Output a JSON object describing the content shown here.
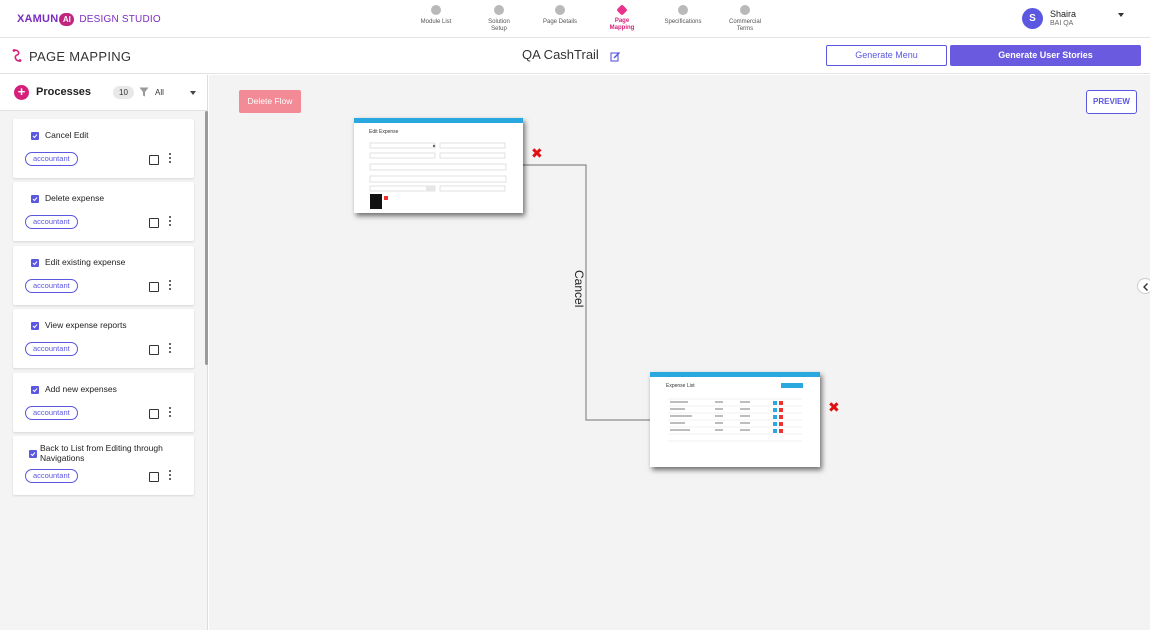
{
  "header": {
    "logo_brand": "XAMUN",
    "logo_ai": "AI",
    "logo_suffix": "DESIGN STUDIO",
    "steps": [
      {
        "label": "Module List",
        "active": false
      },
      {
        "label": "Solution Setup",
        "active": false
      },
      {
        "label": "Page Details",
        "active": false
      },
      {
        "label": "Page Mapping",
        "active": true
      },
      {
        "label": "Specifications",
        "active": false
      },
      {
        "label": "Commercial Terms",
        "active": false
      }
    ],
    "user": {
      "initial": "S",
      "name": "Shaira",
      "role": "BAI QA"
    }
  },
  "subheader": {
    "page_title": "PAGE MAPPING",
    "project_title": "QA CashTrail",
    "generate_menu": "Generate Menu",
    "generate_stories": "Generate User Stories"
  },
  "sidebar": {
    "processes_label": "Processes",
    "count": "10",
    "filter_value": "All",
    "items": [
      {
        "title": "Cancel Edit",
        "role": "accountant"
      },
      {
        "title": "Delete expense",
        "role": "accountant"
      },
      {
        "title": "Edit existing expense",
        "role": "accountant"
      },
      {
        "title": "View expense reports",
        "role": "accountant"
      },
      {
        "title": "Add new expenses",
        "role": "accountant"
      },
      {
        "title": "Back to List from Editing through Navigations",
        "role": "accountant"
      }
    ]
  },
  "canvas": {
    "delete_flow": "Delete Flow",
    "preview": "PREVIEW",
    "flow_label": "Cancel",
    "screen_edit_title": "Edit Expense",
    "screen_list_title": "Expense List"
  },
  "colors": {
    "primary": "#5b57e0",
    "accent_pink": "#d61f7a",
    "delete_flow": "#f28b96",
    "remove_x": "#e01010",
    "screen_bar": "#29a8e0"
  }
}
